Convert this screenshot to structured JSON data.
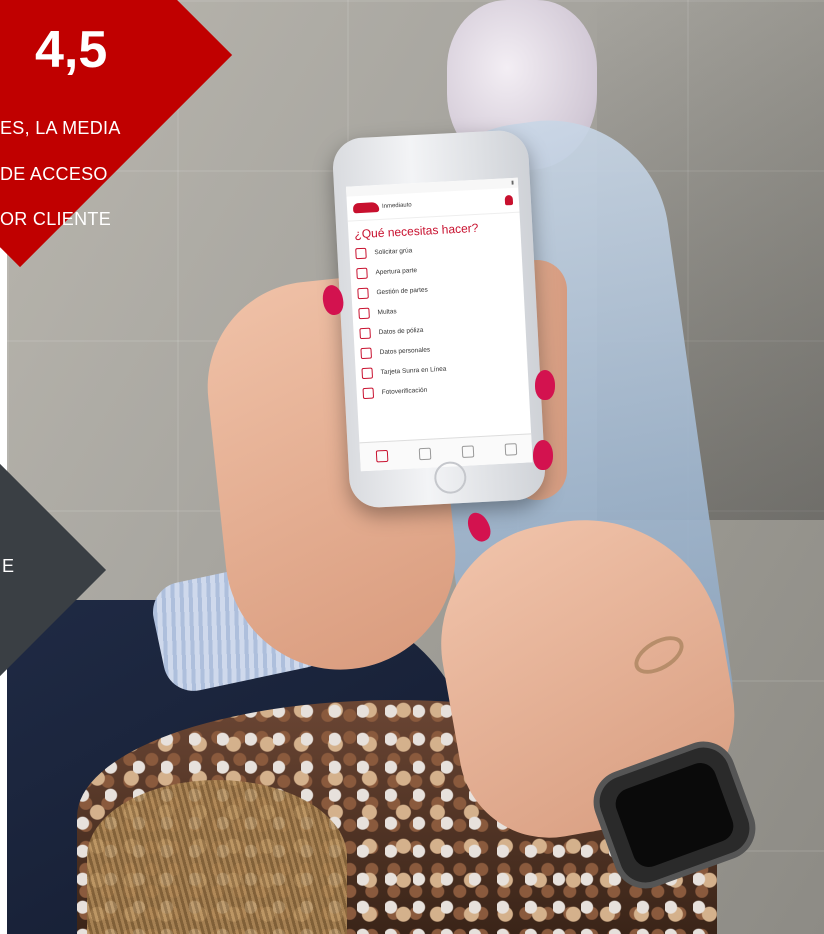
{
  "badge": {
    "value": "4,5",
    "lines": [
      "ES, LA MEDIA",
      "DE ACCESO",
      "OR CLIENTE"
    ],
    "color": "#c00000"
  },
  "dark_badge": {
    "letter": "E",
    "color": "#3a3f44"
  },
  "phone": {
    "brand_name": "Inmediauto",
    "prompt": "¿Qué necesitas hacer?",
    "accent": "#c8102e",
    "menu": [
      {
        "label": "Solicitar grúa",
        "icon": "tow-truck-icon"
      },
      {
        "label": "Apertura parte",
        "icon": "document-open-icon"
      },
      {
        "label": "Gestión de partes",
        "icon": "folder-icon"
      },
      {
        "label": "Multas",
        "icon": "ticket-icon"
      },
      {
        "label": "Datos de póliza",
        "icon": "policy-icon"
      },
      {
        "label": "Datos personales",
        "icon": "id-card-icon"
      },
      {
        "label": "Tarjeta Sunra en Línea",
        "icon": "card-icon"
      },
      {
        "label": "Fotoverificación",
        "icon": "camera-car-icon"
      }
    ],
    "tabs": [
      "home-tab-icon",
      "user-tab-icon",
      "car-tab-icon",
      "tools-tab-icon"
    ]
  }
}
